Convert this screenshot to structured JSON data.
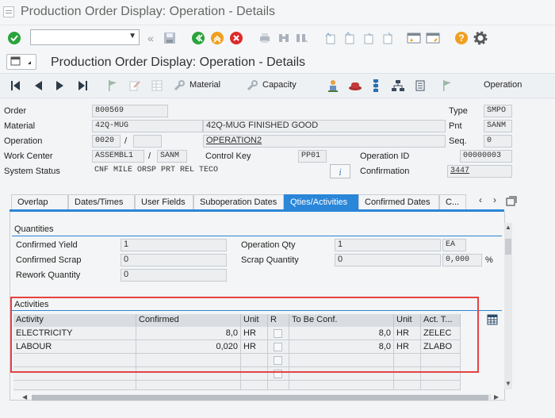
{
  "window": {
    "title": "Production Order Display: Operation - Details"
  },
  "screen_title": "Production Order Display: Operation - Details",
  "app_toolbar": {
    "material_label": "Material",
    "capacity_label": "Capacity",
    "operation_label": "Operation"
  },
  "header": {
    "order_label": "Order",
    "order_value": "800569",
    "type_label": "Type",
    "type_value": "SMPO",
    "material_label": "Material",
    "material_value": "42Q-MUG",
    "material_desc": "42Q-MUG FINISHED GOOD",
    "plant_label": "Pnt",
    "plant_value": "SANM",
    "operation_label": "Operation",
    "operation_value": "0020",
    "operation_sep": "/",
    "operation_desc": "OPERATION2",
    "seq_label": "Seq.",
    "seq_value": "0",
    "work_center_label": "Work Center",
    "work_center_value": "ASSEMBL1",
    "work_center_sep": "/",
    "work_center_plant": "SANM",
    "control_key_label": "Control Key",
    "control_key_value": "PP01",
    "operation_id_label": "Operation ID",
    "operation_id_value": "00000003",
    "system_status_label": "System Status",
    "system_status_value": "CNF  MILE ORSP PRT  REL  TECO",
    "confirmation_label": "Confirmation",
    "confirmation_value": "3447"
  },
  "tabs": [
    "Overlap",
    "Dates/Times",
    "User Fields",
    "Suboperation Dates",
    "Qties/Activities",
    "Confirmed Dates",
    "C..."
  ],
  "active_tab": "Qties/Activities",
  "quantities": {
    "title": "Quantities",
    "confirmed_yield_label": "Confirmed Yield",
    "confirmed_yield_value": "1",
    "confirmed_scrap_label": "Confirmed Scrap",
    "confirmed_scrap_value": "0",
    "rework_qty_label": "Rework Quantity",
    "rework_qty_value": "0",
    "operation_qty_label": "Operation Qty",
    "operation_qty_value": "1",
    "operation_qty_unit": "EA",
    "scrap_qty_label": "Scrap Quantity",
    "scrap_qty_value": "0",
    "scrap_pct_value": "0,000",
    "scrap_pct_sign": "%"
  },
  "activities": {
    "title": "Activities",
    "columns": [
      "Activity",
      "Confirmed",
      "Unit",
      "R",
      "To Be Conf.",
      "Unit",
      "Act. T..."
    ],
    "rows": [
      {
        "activity": "ELECTRICITY",
        "confirmed": "8,0",
        "unit": "HR",
        "to_be_conf": "8,0",
        "unit2": "HR",
        "act_type": "ZELEC"
      },
      {
        "activity": "LABOUR",
        "confirmed": "0,020",
        "unit": "HR",
        "to_be_conf": "8,0",
        "unit2": "HR",
        "act_type": "ZLABO"
      }
    ]
  }
}
